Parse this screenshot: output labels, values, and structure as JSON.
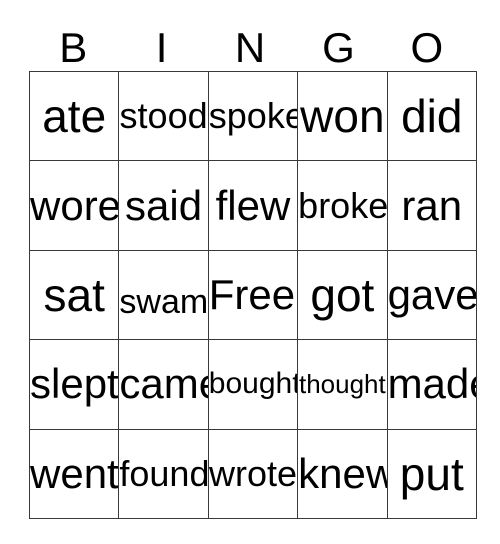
{
  "card": {
    "title_letters": [
      "B",
      "I",
      "N",
      "G",
      "O"
    ],
    "free_space_label": "Free!",
    "grid_rows": [
      [
        {
          "text": "ate",
          "size": "sz-xl"
        },
        {
          "text": "stood",
          "size": "sz-md"
        },
        {
          "text": "spoke",
          "size": "sz-md"
        },
        {
          "text": "won",
          "size": "sz-xl"
        },
        {
          "text": "did",
          "size": "sz-xl"
        }
      ],
      [
        {
          "text": "wore",
          "size": "sz-lg"
        },
        {
          "text": "said",
          "size": "sz-lg"
        },
        {
          "text": "flew",
          "size": "sz-lg"
        },
        {
          "text": "broke",
          "size": "sz-md"
        },
        {
          "text": "ran",
          "size": "sz-lg"
        }
      ],
      [
        {
          "text": "sat",
          "size": "sz-xl"
        },
        {
          "text": "swam",
          "size": "sz-sm"
        },
        {
          "text": "Free!",
          "size": "sz-lg"
        },
        {
          "text": "got",
          "size": "sz-xl"
        },
        {
          "text": "gave",
          "size": "sz-lg"
        }
      ],
      [
        {
          "text": "slept",
          "size": "sz-lg"
        },
        {
          "text": "came",
          "size": "sz-lg"
        },
        {
          "text": "bought",
          "size": "sz-xs"
        },
        {
          "text": "thought",
          "size": "sz-xxs"
        },
        {
          "text": "made",
          "size": "sz-lg"
        }
      ],
      [
        {
          "text": "went",
          "size": "sz-lg"
        },
        {
          "text": "found",
          "size": "sz-md"
        },
        {
          "text": "wrote",
          "size": "sz-md"
        },
        {
          "text": "knew",
          "size": "sz-lg"
        },
        {
          "text": "put",
          "size": "sz-xl"
        }
      ]
    ]
  },
  "colors": {
    "background": "#ffffff",
    "text": "#000000",
    "grid_line": "#3a3a3a"
  }
}
